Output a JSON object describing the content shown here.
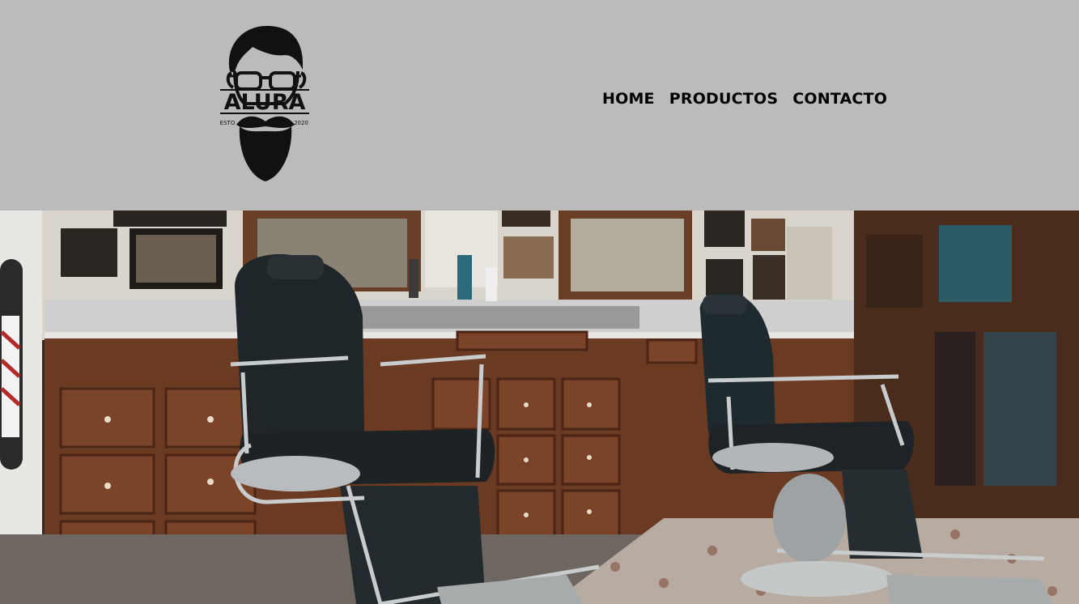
{
  "header": {
    "background_color": "#bbbbbb",
    "logo": {
      "brand": "ALURA",
      "left_text": "ESTO",
      "right_text": "2020",
      "icon": "bearded-man-glasses-icon"
    },
    "nav": {
      "items": [
        {
          "label": "HOME"
        },
        {
          "label": "PRODUCTOS"
        },
        {
          "label": "CONTACTO"
        }
      ]
    }
  },
  "banner": {
    "subject": "barbershop-interior-photo"
  }
}
